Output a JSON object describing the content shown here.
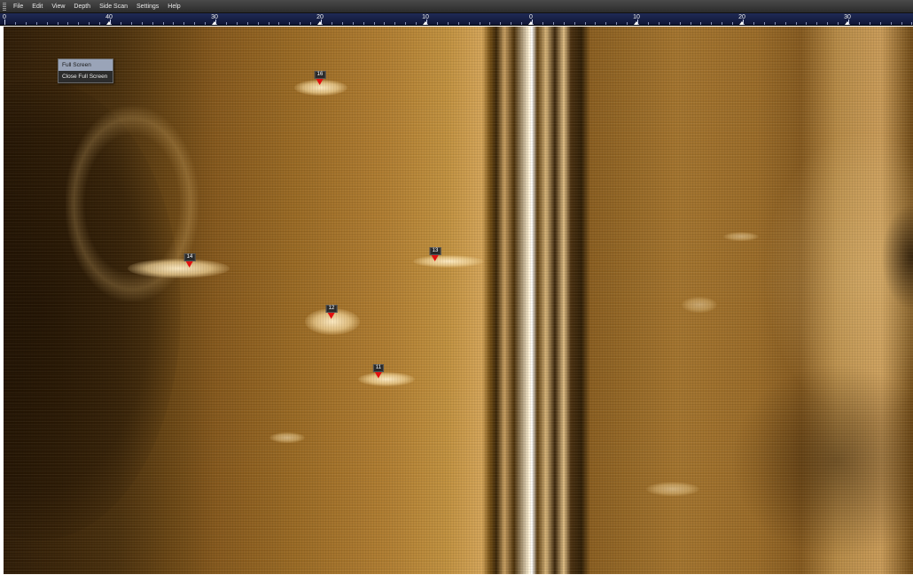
{
  "menubar": {
    "items": [
      "File",
      "Edit",
      "View",
      "Depth",
      "Side Scan",
      "Settings",
      "Help"
    ]
  },
  "ruler": {
    "labels": [
      "0",
      "40",
      "30",
      "20",
      "10",
      "0",
      "10",
      "20",
      "30"
    ]
  },
  "context_menu": {
    "items": [
      "Full Screen",
      "Close Full Screen"
    ],
    "highlighted_index": 0
  },
  "waypoints": [
    {
      "label": "16"
    },
    {
      "label": "14"
    },
    {
      "label": "13"
    },
    {
      "label": "12"
    },
    {
      "label": "11"
    }
  ],
  "colors": {
    "marker": "#e01010",
    "ruler_bg": "#1f2a55",
    "menubar_bg": "#3a3a3a"
  }
}
